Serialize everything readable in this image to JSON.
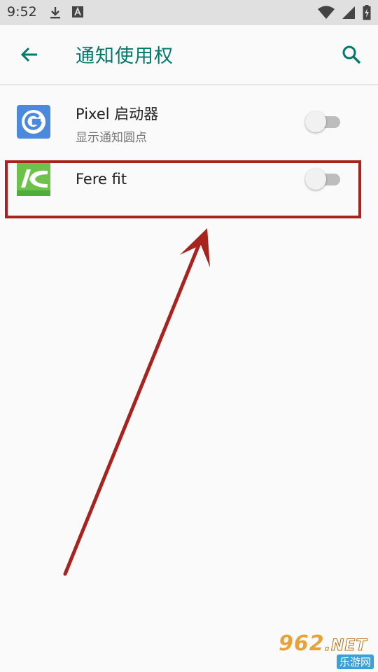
{
  "status_bar": {
    "time": "9:52",
    "left_icons": [
      "download-icon",
      "app-a-icon"
    ],
    "right_icons": [
      "wifi-icon",
      "signal-icon",
      "battery-charging-icon"
    ]
  },
  "app_bar": {
    "title": "通知使用权",
    "back_icon": "arrow-back-icon",
    "search_icon": "search-icon",
    "accent_color": "#00796b"
  },
  "apps": [
    {
      "name": "Pixel 启动器",
      "subtitle": "显示通知圆点",
      "icon": "pixel-launcher-icon",
      "enabled": false
    },
    {
      "name": "Fere fit",
      "subtitle": "",
      "icon": "fere-fit-icon",
      "enabled": false
    }
  ],
  "annotation": {
    "color": "#a8221e"
  },
  "watermark": {
    "top": "962",
    "net": ".NET",
    "bottom": "乐游网"
  }
}
